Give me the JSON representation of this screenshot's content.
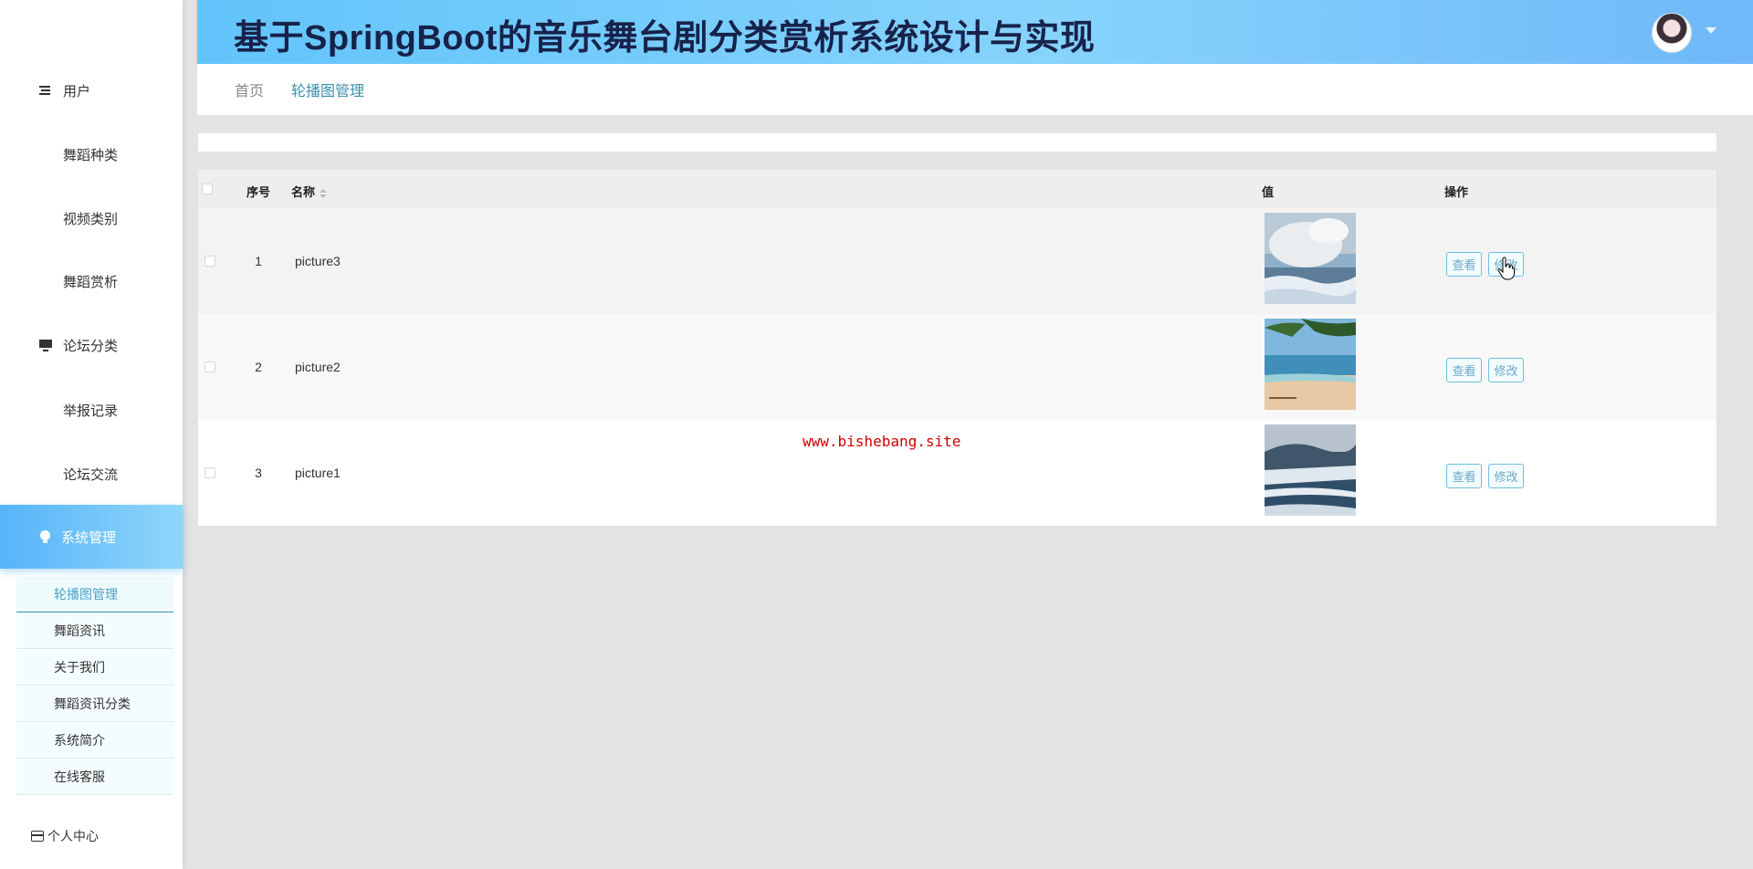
{
  "header": {
    "title": "基于SpringBoot的音乐舞台剧分类赏析系统设计与实现"
  },
  "sidebar": {
    "items": [
      {
        "label": "用户",
        "icon": "list-icon"
      },
      {
        "label": "舞蹈种类",
        "icon": "grid-icon"
      },
      {
        "label": "视频类别",
        "icon": "grid-icon"
      },
      {
        "label": "舞蹈赏析",
        "icon": "grid-icon"
      },
      {
        "label": "论坛分类",
        "icon": "monitor-icon"
      },
      {
        "label": "举报记录",
        "icon": "grid-icon"
      },
      {
        "label": "论坛交流",
        "icon": "grid-icon"
      },
      {
        "label": "系统管理",
        "icon": "bulb-icon"
      }
    ],
    "submenu": [
      "轮播图管理",
      "舞蹈资讯",
      "关于我们",
      "舞蹈资讯分类",
      "系统简介",
      "在线客服"
    ],
    "personal": "个人中心"
  },
  "breadcrumb": {
    "home": "首页",
    "current": "轮播图管理"
  },
  "table": {
    "columns": {
      "index": "序号",
      "name": "名称",
      "value": "值",
      "actions": "操作"
    },
    "rows": [
      {
        "index": "1",
        "name": "picture3"
      },
      {
        "index": "2",
        "name": "picture2"
      },
      {
        "index": "3",
        "name": "picture1"
      }
    ],
    "view_label": "查看",
    "edit_label": "修改"
  },
  "watermark": "www.bishebang.site",
  "colors": {
    "accent": "#56b4f9",
    "header_title": "#17224a",
    "link": "#3a8fa8"
  }
}
